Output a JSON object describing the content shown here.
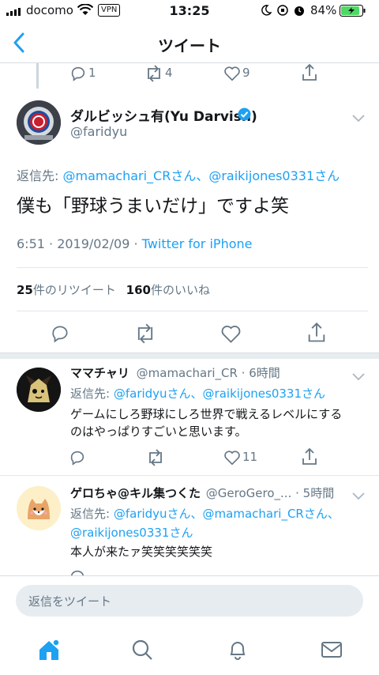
{
  "status_bar": {
    "carrier": "docomo",
    "vpn": "VPN",
    "time": "13:25",
    "battery": "84%"
  },
  "nav": {
    "title": "ツイート"
  },
  "prev_tweet_actions": {
    "reply_count": "1",
    "retweet_count": "4",
    "like_count": "9"
  },
  "main_tweet": {
    "name": "ダルビッシュ有(Yu Darvish)",
    "handle": "@faridyu",
    "reply_prefix": "返信先:",
    "reply_to": "@mamachari_CRさん、@raikijones0331さん",
    "text": "僕も「野球うまいだけ」ですよ笑",
    "timestamp": "6:51 · 2019/02/09 · ",
    "client": "Twitter for iPhone",
    "retweet_num": "25",
    "retweet_label": "件のリツイート",
    "like_num": "160",
    "like_label": "件のいいね"
  },
  "replies": [
    {
      "name": "ママチャリ",
      "handle_time": "@mamachari_CR · 6時間",
      "reply_prefix": "返信先:",
      "reply_to": "@faridyuさん、@raikijones0331さん",
      "text_line1": "ゲームにしろ野球にしろ世界で戦えるレベルにする",
      "text_line2": "のはやっぱりすごいと思います。",
      "like_count": "11"
    },
    {
      "name": "ゲロちゃ@キル集つくた",
      "handle": "@GeroGero_...",
      "time": " · 5時間",
      "reply_prefix": "返信先:",
      "reply_to_line1": "@faridyuさん、@mamachari_CRさん、",
      "reply_to_line2": "@raikijones0331さん",
      "text": "本人が来たァ笑笑笑笑笑笑"
    }
  ],
  "reply_input": {
    "placeholder": "返信をツイート"
  },
  "colors": {
    "accent": "#1da1f2",
    "muted": "#657786",
    "separator": "#e1e8ed"
  },
  "icons": [
    "back-icon",
    "reply-icon",
    "retweet-icon",
    "like-icon",
    "share-icon",
    "verified-icon",
    "chevron-down-icon",
    "home-icon",
    "search-icon",
    "bell-icon",
    "mail-icon"
  ]
}
